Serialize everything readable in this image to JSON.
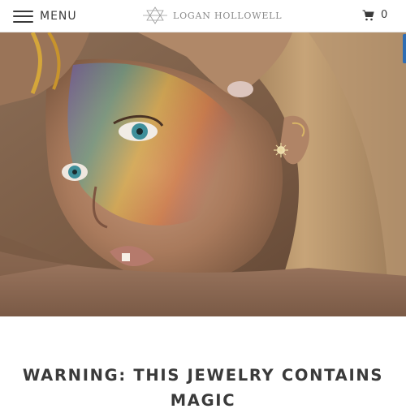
{
  "header": {
    "menu_label": "MENU",
    "menu_icon": "hamburger-icon",
    "logo_text": "LOGAN HOLLOWELL",
    "logo_icon": "star-of-david-logo",
    "cart_icon": "shopping-cart-icon",
    "cart_count": "0"
  },
  "hero": {
    "image_subject": "close-up portrait of a woman with a rainbow light prism across her face"
  },
  "main": {
    "headline": "WARNING: THIS JEWELRY CONTAINS MAGIC"
  },
  "colors": {
    "text": "#3a3a3a",
    "logo_gray": "#8a8a8a",
    "accent_tab": "#2f6db3"
  }
}
